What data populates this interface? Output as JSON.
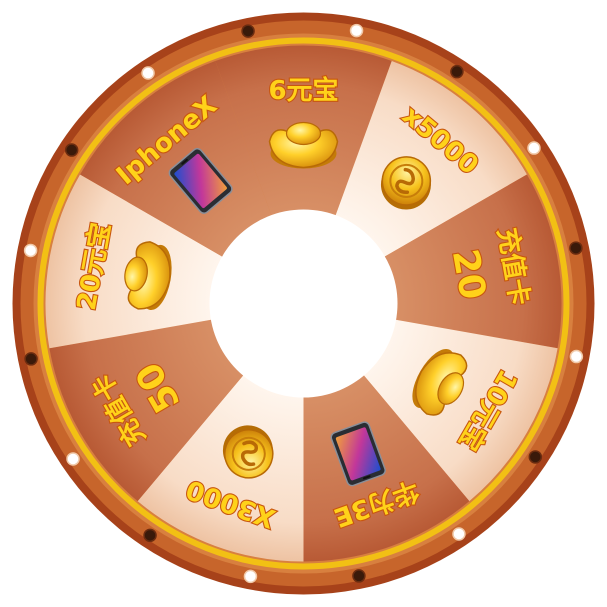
{
  "wheel": {
    "colors": {
      "rim_outer": "#a7421a",
      "rim_mid": "#c86a2c",
      "rim_inner": "#e08a45",
      "gold_ring": "#f4c51b",
      "segment_dark": "#cf7f55",
      "segment_light": "#fbe6d6",
      "label_fill": "#ffd21a",
      "label_stroke": "#c8560f",
      "center": "#ffffff"
    },
    "rim_lights": [
      "white",
      "dark",
      "white",
      "dark",
      "white",
      "dark",
      "white",
      "dark",
      "white",
      "dark",
      "white",
      "dark",
      "white",
      "dark",
      "white",
      "dark"
    ],
    "prizes": [
      {
        "label": "6元宝",
        "icon": "gold-ingot-icon",
        "second_line": ""
      },
      {
        "label": "x5000",
        "icon": "coin-icon",
        "second_line": ""
      },
      {
        "label": "充值卡",
        "icon": "",
        "second_line": "20"
      },
      {
        "label": "10元宝",
        "icon": "gold-ingot-icon",
        "second_line": ""
      },
      {
        "label": "华为3E",
        "icon": "phone-icon",
        "second_line": ""
      },
      {
        "label": "X3000",
        "icon": "coin-icon",
        "second_line": ""
      },
      {
        "label": "充值卡",
        "icon": "",
        "second_line": "50"
      },
      {
        "label": "20元宝",
        "icon": "gold-ingot-icon",
        "second_line": ""
      },
      {
        "label": "IphoneX",
        "icon": "phone-icon",
        "second_line": ""
      }
    ]
  }
}
